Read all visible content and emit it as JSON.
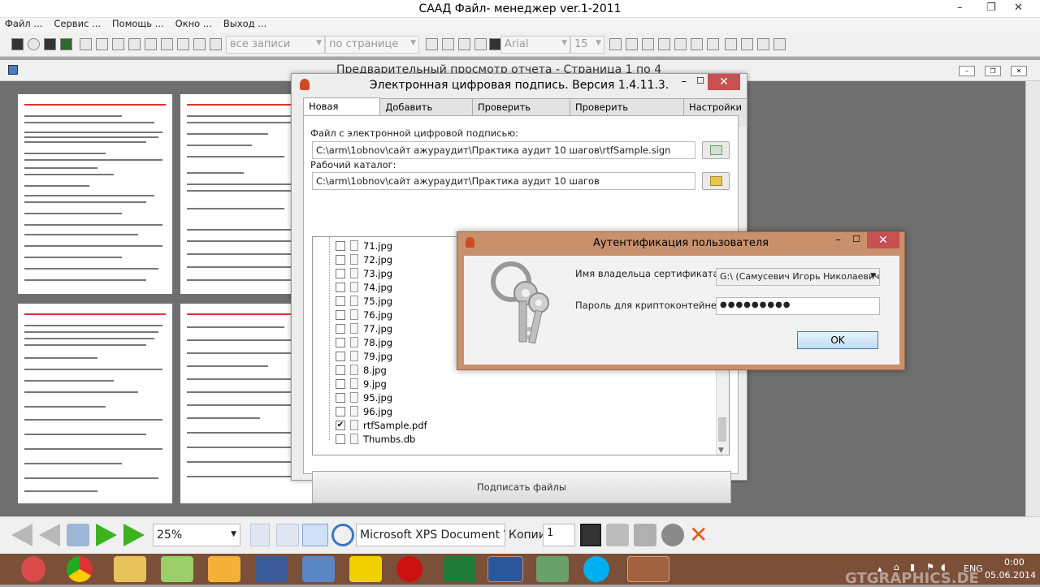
{
  "app": {
    "title": "САAД Файл- менеджер ver.1-2011",
    "window_controls": [
      "–",
      "❐",
      "✕"
    ]
  },
  "menu": [
    "Файл ...",
    "Сервис ...",
    "Помощь ...",
    "Окно ...",
    "Выход ..."
  ],
  "toolbar": {
    "records_combo": "все записи",
    "page_combo": "по странице",
    "font_combo": "Arial",
    "size_combo": "15"
  },
  "preview": {
    "title": "Предварительный просмотр отчета - Страница 1 по 4"
  },
  "signature_window": {
    "title": "Электронная цифровая подпись. Версия 1.4.11.3.",
    "tabs": [
      "Новая подпись",
      "Добавить подпись",
      "Проверить подпись",
      "Проверить сертификат",
      "Настройки"
    ],
    "file_label": "Файл с электронной цифровой подписью:",
    "file_value": "C:\\arm\\1obnov\\сайт ажураудит\\Практика аудит 10 шагов\\rtfSample.sign",
    "dir_label": "Рабочий каталог:",
    "dir_value": "C:\\arm\\1obnov\\сайт ажураудит\\Практика аудит 10 шагов",
    "files": [
      {
        "name": "71.jpg",
        "checked": false
      },
      {
        "name": "72.jpg",
        "checked": false
      },
      {
        "name": "73.jpg",
        "checked": false
      },
      {
        "name": "74.jpg",
        "checked": false
      },
      {
        "name": "75.jpg",
        "checked": false
      },
      {
        "name": "76.jpg",
        "checked": false
      },
      {
        "name": "77.jpg",
        "checked": false
      },
      {
        "name": "78.jpg",
        "checked": false
      },
      {
        "name": "79.jpg",
        "checked": false
      },
      {
        "name": "8.jpg",
        "checked": false
      },
      {
        "name": "9.jpg",
        "checked": false
      },
      {
        "name": "95.jpg",
        "checked": false
      },
      {
        "name": "96.jpg",
        "checked": false
      },
      {
        "name": "rtfSample.pdf",
        "checked": true
      },
      {
        "name": "Thumbs.db",
        "checked": false
      }
    ],
    "sign_button": "Подписать файлы"
  },
  "auth_dialog": {
    "title": "Аутентификация пользователя",
    "owner_label": "Имя владельца сертификата:",
    "owner_value": "G:\\ (Самусевич Игорь Николаевич",
    "password_label": "Пароль для криптоконтейнера:",
    "password_value": "●●●●●●●●●",
    "ok_label": "OK"
  },
  "bottom_toolbar": {
    "zoom": "25%",
    "printer": "Microsoft XPS Document W",
    "copies_label": "Копии",
    "copies_value": "1"
  },
  "taskbar": {
    "language": "ENG",
    "time": "0:00",
    "date": "05.06.2014",
    "watermark": "GTGRAPHICS.DE"
  },
  "colors": {
    "accent_taskbar": "#7b4f38",
    "auth_frame": "#c9906d",
    "close_red": "#c75050",
    "page_header_red": "#dd3333"
  }
}
